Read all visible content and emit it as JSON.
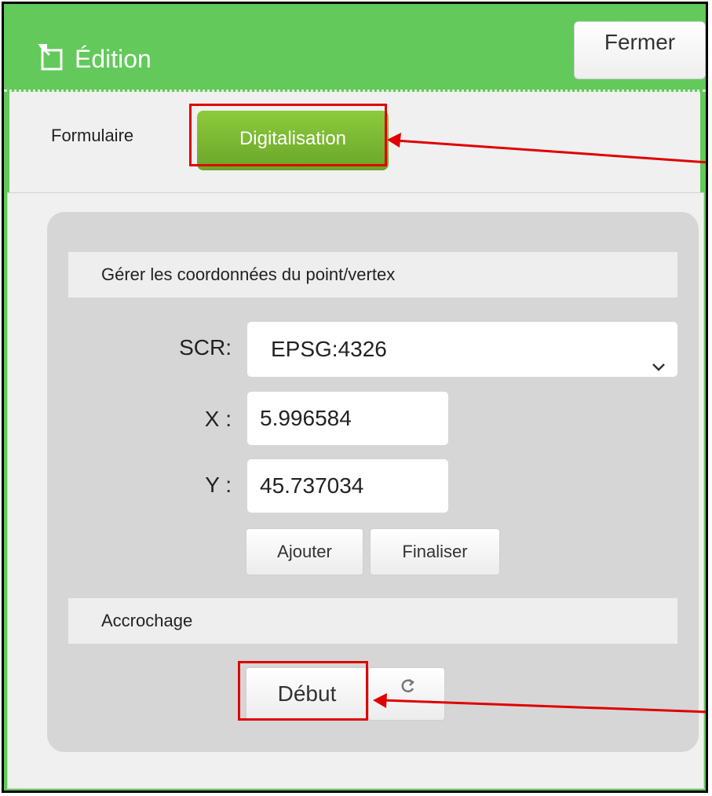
{
  "header": {
    "title": "Édition",
    "close_label": "Fermer"
  },
  "tabs": [
    {
      "label": "Formulaire",
      "active": false
    },
    {
      "label": "Digitalisation",
      "active": true
    }
  ],
  "coords_section": {
    "title": "Gérer les coordonnées du point/vertex",
    "crs_label": "SCR:",
    "crs_value": "EPSG:4326",
    "x_label": "X :",
    "x_value": "5.996584",
    "y_label": "Y :",
    "y_value": "45.737034",
    "add_label": "Ajouter",
    "finish_label": "Finaliser"
  },
  "snap_section": {
    "title": "Accrochage",
    "start_label": "Début"
  },
  "colors": {
    "header_green": "#62c95a",
    "tab_green": "#7ab833",
    "annotation_red": "#e00000"
  },
  "icons": {
    "edit": "edit-icon",
    "dropdown": "chevron-down-icon",
    "refresh": "refresh-icon"
  }
}
